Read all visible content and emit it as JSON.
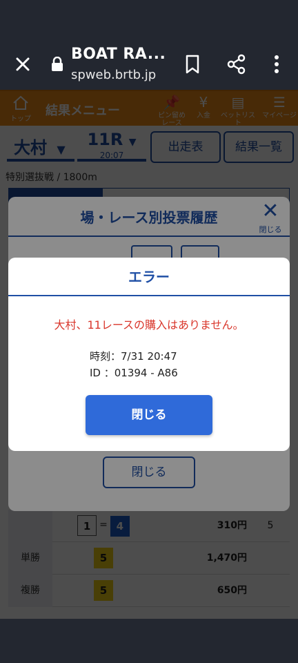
{
  "browser": {
    "title": "BOAT RA...",
    "url": "spweb.brtb.jp"
  },
  "header": {
    "home_label": "トップ",
    "menu_title": "結果メニュー",
    "tools": [
      {
        "label": "ピン留め\nレース",
        "icon": "pin-icon"
      },
      {
        "label": "入金",
        "icon": "deposit-icon"
      },
      {
        "label": "ベットリスト",
        "icon": "betlist-icon"
      },
      {
        "label": "マイページ",
        "icon": "menu-icon"
      }
    ]
  },
  "selector": {
    "place": "大村",
    "race": "11R",
    "time": "20:07",
    "btn_entry": "出走表",
    "btn_results": "結果一覧"
  },
  "race_info": "特別選抜戦 / 1800m",
  "history_modal": {
    "title": "場・レース別投票履歴",
    "close_x_label": "閉じる",
    "close_button": "閉じる"
  },
  "results_table": {
    "rows": [
      {
        "type": "",
        "boats": [
          "1",
          "4"
        ],
        "sep": "=",
        "payout": "310円",
        "pop": "5"
      },
      {
        "type": "単勝",
        "boats": [
          "5"
        ],
        "sep": "",
        "payout": "1,470円",
        "pop": ""
      },
      {
        "type": "複勝",
        "boats": [
          "5"
        ],
        "sep": "",
        "payout": "650円",
        "pop": ""
      }
    ]
  },
  "error_dialog": {
    "title": "エラー",
    "message": "大村、11レースの購入はありません。",
    "time_line": "時刻：7/31 20:47",
    "id_line": "ID ：01394 - A86",
    "close_button": "閉じる"
  },
  "colors": {
    "primary": "#1f4fa5",
    "button": "#2f6ad9",
    "error_text": "#d9362b",
    "header_orange": "#ef8c1a"
  }
}
